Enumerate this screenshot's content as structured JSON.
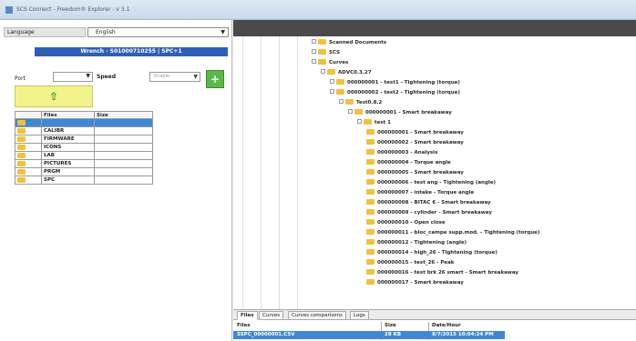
{
  "window": {
    "title": "SCS Connect - Freedom® Explorer - v 3.1"
  },
  "language": {
    "label": "Language",
    "value": "English"
  },
  "wrench": {
    "header": "Wrench - S01000710255 | SPC+1"
  },
  "port": {
    "label": "Port",
    "value": ""
  },
  "speed": {
    "label": "Speed",
    "value": "Enable"
  },
  "files_table": {
    "headers": [
      "",
      "Files",
      "Size"
    ],
    "rows": [
      {
        "name": "",
        "size": "",
        "selected": true
      },
      {
        "name": "CALIBR",
        "size": "",
        "selected": false
      },
      {
        "name": "FIRMWARE",
        "size": "",
        "selected": false
      },
      {
        "name": "ICONS",
        "size": "",
        "selected": false
      },
      {
        "name": "LAB",
        "size": "",
        "selected": false
      },
      {
        "name": "PICTURES",
        "size": "",
        "selected": false
      },
      {
        "name": "PRGM",
        "size": "",
        "selected": false
      },
      {
        "name": "SPC",
        "size": "",
        "selected": false
      }
    ]
  },
  "tree": {
    "nodes": [
      {
        "label": "Scanned Documents",
        "level": 0
      },
      {
        "label": "SCS",
        "level": 0
      },
      {
        "label": "Curves",
        "level": 1
      },
      {
        "label": "ADVC0.3.27",
        "level": 2
      },
      {
        "label": "000000001 - test1 - Tightening (torque)",
        "level": 3
      },
      {
        "label": "000000002 - test2 - Tightening (torque)",
        "level": 3
      },
      {
        "label": "Test0.8.2",
        "level": 4
      },
      {
        "label": "000000001 - Smart breakaway",
        "level": 5
      },
      {
        "label": "test 1",
        "level": 6
      },
      {
        "label": "000000001 - Smart breakaway",
        "level": 7
      },
      {
        "label": "000000002 - Smart breakaway",
        "level": 7
      },
      {
        "label": "000000003 - Analysis",
        "level": 7
      },
      {
        "label": "000000004 - Torque angle",
        "level": 7
      },
      {
        "label": "000000005 - Smart breakaway",
        "level": 7
      },
      {
        "label": "000000006 - test ang - Tightening (angle)",
        "level": 7
      },
      {
        "label": "000000007 - intake - Torque angle",
        "level": 7
      },
      {
        "label": "000000008 - BITAC 6 - Smart breakaway",
        "level": 7
      },
      {
        "label": "000000009 - cylinder - Smart breakaway",
        "level": 7
      },
      {
        "label": "000000010 - Open close",
        "level": 7
      },
      {
        "label": "000000011 - bloc_campe supp.mod. - Tightening (torque)",
        "level": 7
      },
      {
        "label": "000000012 - Tightening (angle)",
        "level": 7
      },
      {
        "label": "000000014 - high_26 - Tightening (torque)",
        "level": 7
      },
      {
        "label": "000000015 - test_26 - Peak",
        "level": 7
      },
      {
        "label": "000000016 - test brk 26 smart - Smart breakaway",
        "level": 7
      },
      {
        "label": "000000017 - Smart breakaway",
        "level": 7
      }
    ]
  },
  "tabs": [
    {
      "label": "Files",
      "active": true
    },
    {
      "label": "Curves",
      "active": false
    },
    {
      "label": "Curves comparisons",
      "active": false
    },
    {
      "label": "Logs",
      "active": false
    }
  ],
  "bottom_table": {
    "headers": {
      "files": "Files",
      "size": "Size",
      "date": "Date/Hour"
    },
    "row": {
      "file": "SSPC_00000001.CSV",
      "size": "28 KB",
      "date": "8/7/2015 10:04:24 PM"
    }
  }
}
